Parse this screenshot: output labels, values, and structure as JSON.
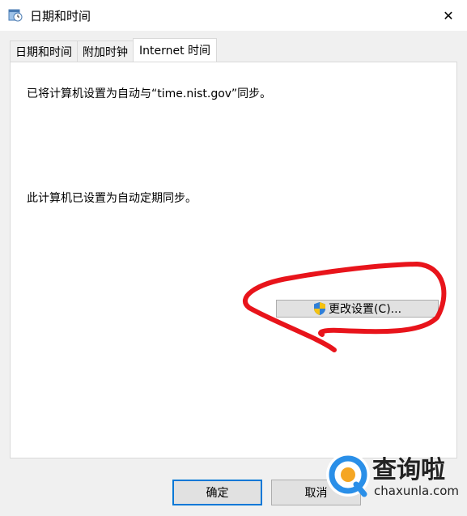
{
  "window": {
    "title": "日期和时间",
    "close_glyph": "✕"
  },
  "tabs": [
    {
      "label": "日期和时间",
      "active": false
    },
    {
      "label": "附加时钟",
      "active": false
    },
    {
      "label": "Internet 时间",
      "active": true
    }
  ],
  "panel": {
    "sync_text": "已将计算机设置为自动与“time.nist.gov”同步。",
    "status_text": "此计算机已设置为自动定期同步。",
    "change_settings_label": "更改设置(C)...",
    "change_settings_icon": "uac-shield-icon"
  },
  "footer": {
    "ok_label": "确定",
    "cancel_label": "取消"
  },
  "watermark": {
    "name": "查询啦",
    "domain": "chaxunla.com"
  },
  "colors": {
    "annotation": "#e8141b",
    "accent": "#0078d7",
    "watermark_blue": "#2a8fe8",
    "watermark_orange": "#f5a623"
  }
}
